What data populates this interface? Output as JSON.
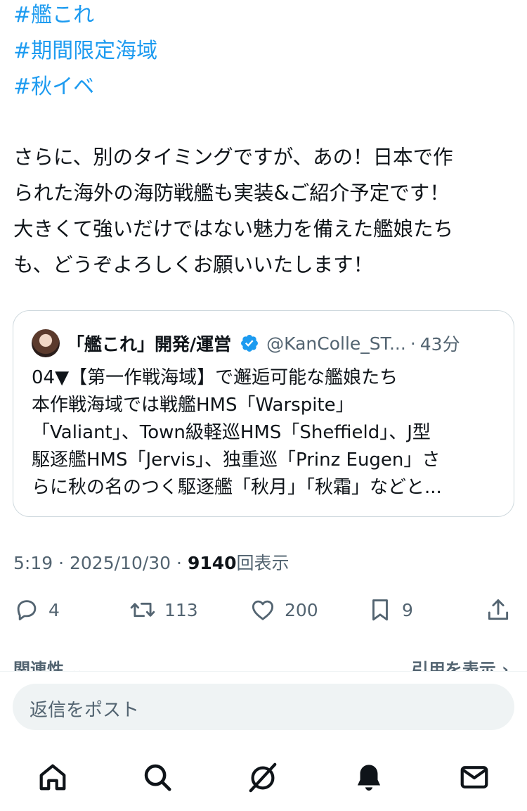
{
  "hashtags": [
    "#艦これ",
    "#期間限定海域",
    "#秋イベ"
  ],
  "tweet_text": "さらに、別のタイミングですが、あの！日本で作\nられた海外の海防戦艦も実装&ご紹介予定です！\n大きくて強いだけではない魅力を備えた艦娘たち\nも、どうぞよろしくお願いいたします！",
  "quote": {
    "author_name": "「艦これ」開発/運営",
    "handle": "@KanColle_ST...",
    "separator": "·",
    "time": "43分",
    "text": "04▼【第一作戦海域】で邂逅可能な艦娘たち\n本作戦海域では戦艦HMS「Warspite」\n「Valiant」、Town級軽巡HMS「Sheffield」、J型\n駆逐艦HMS「Jervis」、独重巡「Prinz Eugen」さ\nらに秋の名のつく駆逐艦「秋月」「秋霜」などと..."
  },
  "meta": {
    "time": "5:19",
    "dot1": "·",
    "date": "2025/10/30",
    "dot2": "·",
    "views": "9140",
    "views_label": "回表示"
  },
  "actions": {
    "replies": "4",
    "reposts": "113",
    "likes": "200",
    "bookmarks": "9"
  },
  "related": {
    "left": "関連性 ⌄",
    "right": "引用を表示 ›"
  },
  "reply_placeholder": "返信をポスト",
  "colors": {
    "accent": "#1d9bf0",
    "text": "#0f1419",
    "secondary": "#536471",
    "border": "#cfd9de"
  },
  "nav_icons": [
    "home-icon",
    "search-icon",
    "grok-icon",
    "notifications-icon",
    "messages-icon"
  ]
}
